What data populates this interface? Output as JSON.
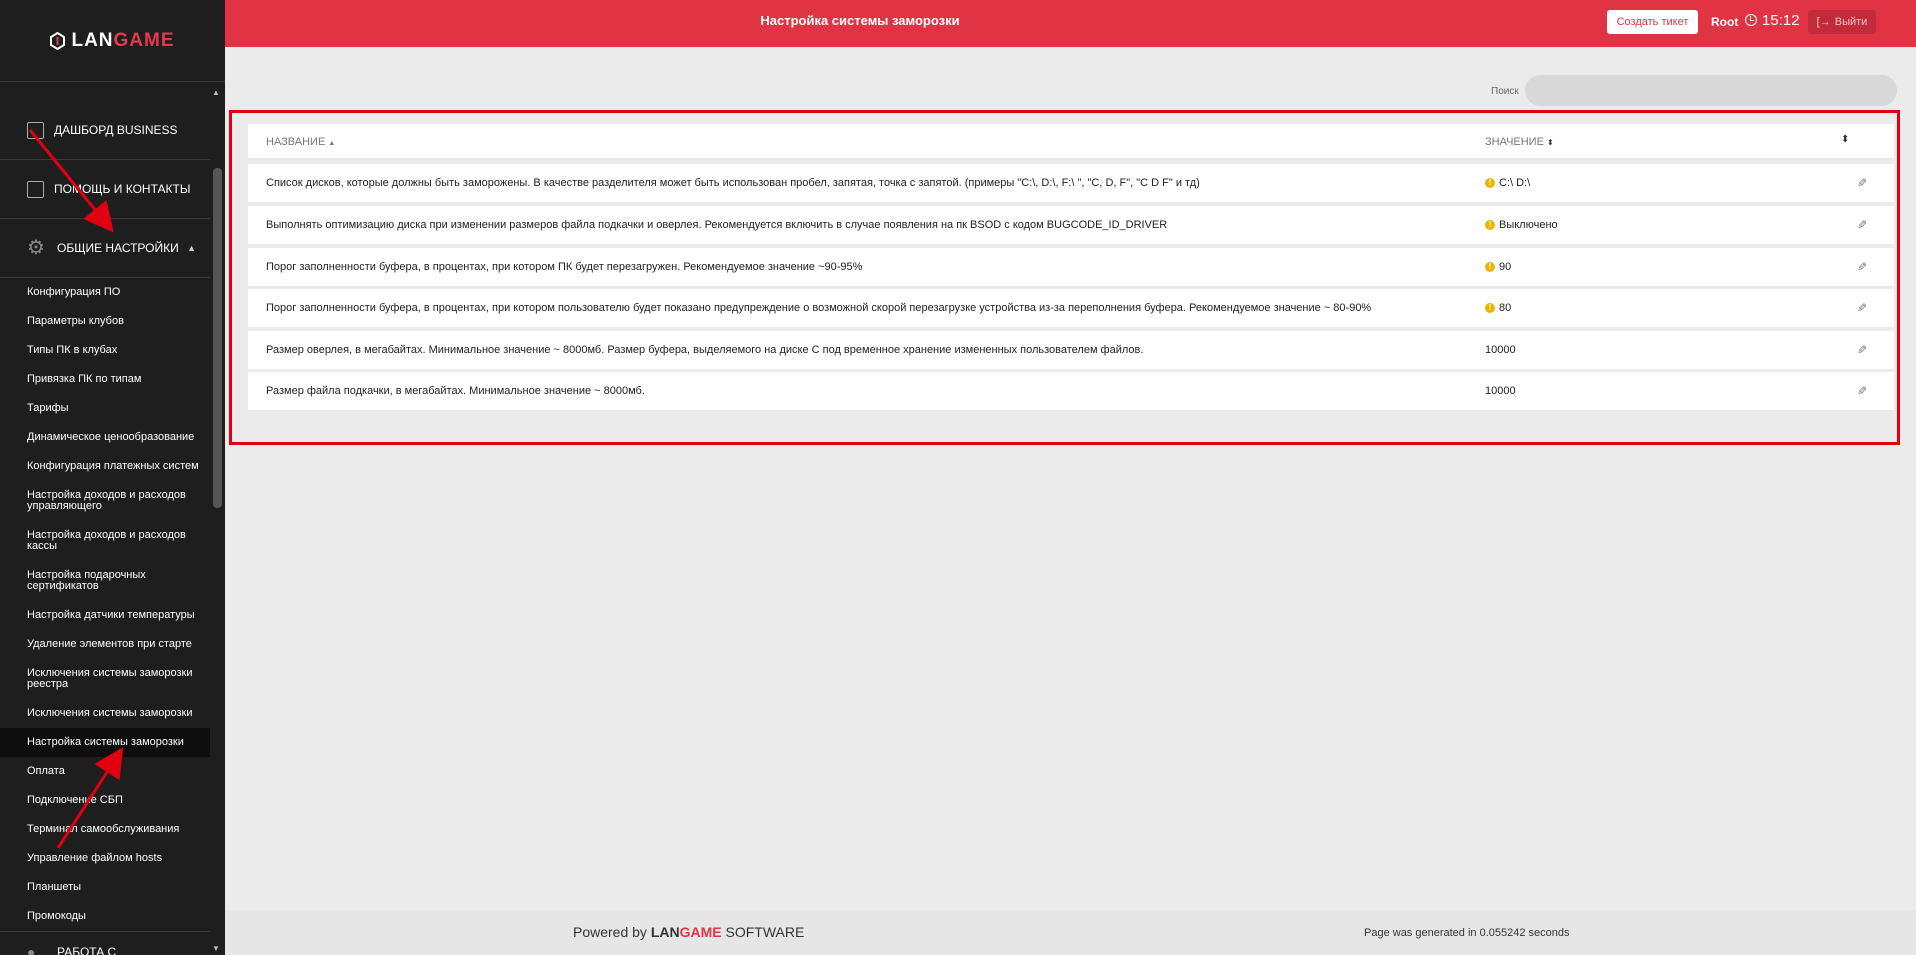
{
  "brand": {
    "part1": "LAN",
    "part2": "GAME"
  },
  "header": {
    "title": "Настройка системы заморозки",
    "ticket_button": "Создать тикет",
    "user": "Root",
    "time": "15:12",
    "logout": "Выйти"
  },
  "sidebar": {
    "blocks": [
      {
        "label": "ДАШБОРД BUSINESS",
        "icon": "checkbox-icon"
      },
      {
        "label": "ПОМОЩЬ И КОНТАКТЫ",
        "icon": "edit-icon"
      },
      {
        "label": "ОБЩИЕ НАСТРОЙКИ",
        "icon": "gear-icon"
      }
    ],
    "items": [
      "Конфигурация ПО",
      "Параметры клубов",
      "Типы ПК в клубах",
      "Привязка ПК по типам",
      "Тарифы",
      "Динамическое ценообразование",
      "Конфигурация платежных систем",
      "Настройка доходов и расходов управляющего",
      "Настройка доходов и расходов кассы",
      "Настройка подарочных сертификатов",
      "Настройка датчики температуры",
      "Удаление элементов при старте",
      "Исключения системы заморозки реестра",
      "Исключения системы заморозки",
      "Настройка системы заморозки",
      "Оплата",
      "Подключение СБП",
      "Терминал самообслуживания",
      "Управление файлом hosts",
      "Планшеты",
      "Промокоды"
    ],
    "bottom_block": "РАБОТА С",
    "active_item": "Настройка системы заморозки"
  },
  "search": {
    "label": "Поиск",
    "value": ""
  },
  "table": {
    "columns": [
      "НАЗВАНИЕ",
      "ЗНАЧЕНИЕ"
    ],
    "rows": [
      {
        "name": "Список дисков, которые должны быть заморожены. В качестве разделителя может быть использован пробел, запятая, точка с запятой. (примеры \"C:\\, D:\\, F:\\ \", \"C, D, F\", \"C D F\" и тд)",
        "value": "C:\\ D:\\",
        "warning": true
      },
      {
        "name": "Выполнять оптимизацию диска при изменении размеров файла подкачки и оверлея. Рекомендуется включить в случае появления на пк BSOD с кодом BUGCODE_ID_DRIVER",
        "value": "Выключено",
        "warning": true
      },
      {
        "name": "Порог заполненности буфера, в процентах, при котором ПК будет перезагружен. Рекомендуемое значение ~90-95%",
        "value": "90",
        "warning": true
      },
      {
        "name": "Порог заполненности буфера, в процентах, при котором пользователю будет показано предупреждение о возможной скорой перезагрузке устройства из-за переполнения буфера. Рекомендуемое значение ~ 80-90%",
        "value": "80",
        "warning": true
      },
      {
        "name": "Размер оверлея, в мегабайтах. Минимальное значение ~ 8000мб. Размер буфера, выделяемого на диске C под временное хранение измененных пользователем файлов.",
        "value": "10000",
        "warning": false
      },
      {
        "name": "Размер файла подкачки, в мегабайтах. Минимальное значение ~ 8000мб.",
        "value": "10000",
        "warning": false
      }
    ]
  },
  "footer": {
    "powered_by": "Powered by",
    "brand_part1": "LAN",
    "brand_part2": "GAME",
    "software": "SOFTWARE",
    "generated": "Page was generated in 0.055242 seconds"
  },
  "colors": {
    "accent": "#e03444",
    "sidebar_bg": "#1e1e1e",
    "highlight_frame": "#e0000f",
    "warning": "#f0b400"
  }
}
